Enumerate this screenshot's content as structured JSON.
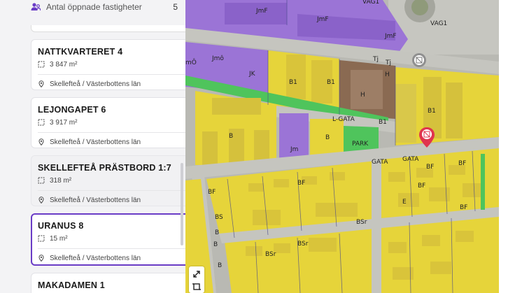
{
  "sidebar": {
    "counter_label": "Antal öppnade fastigheter",
    "counter_value": "5",
    "properties": [
      {
        "name": "NATTKVARTERET 4",
        "area": "3 847 m²",
        "location": "Skellefteå / Västerbottens län"
      },
      {
        "name": "LEJONGAPET 6",
        "area": "3 917 m²",
        "location": "Skellefteå / Västerbottens län"
      },
      {
        "name": "SKELLEFTEÅ PRÄSTBORD 1:7",
        "area": "318 m²",
        "location": "Skellefteå / Västerbottens län"
      },
      {
        "name": "URANUS 8",
        "area": "15 m²",
        "location": "Skellefteå / Västerbottens län"
      },
      {
        "name": "MAKADAMEN 1"
      }
    ]
  },
  "map": {
    "labels": {
      "vag1_top": "VAG1",
      "vag1": "VAG1",
      "jmf1": "JmF",
      "jmf2": "JmF",
      "jmf3": "JmF",
      "jmo1": "Jmô",
      "jmo2": "mÔ",
      "jk": "JK",
      "tj1": "Tj",
      "tj2": "Tj",
      "h1": "H",
      "h2": "H",
      "b1a": "B1",
      "b1b": "B1",
      "b1c": "B1",
      "b1d": "B1",
      "lgata": "L-GATA",
      "b_a": "B",
      "b_b": "B",
      "jm": "Jm",
      "park": "PARK",
      "gata1": "GATA",
      "gata2": "GATA",
      "bf1": "BF",
      "bf2": "BF",
      "bf3": "BF",
      "bf4": "BF",
      "bf5": "BF",
      "bf6": "BF",
      "e": "E",
      "bs": "BS",
      "bsr1": "BSr",
      "bsr2": "BSr",
      "bsr3": "BSr",
      "b_c": "B",
      "b_d": "B",
      "b_e": "B"
    },
    "colors": {
      "residential": "#e6d43a",
      "commercial": "#9b74d6",
      "park": "#4fc45c",
      "road": "#bdbdb8",
      "hospital": "#8a6a52",
      "marker": "#e0344e",
      "selection": "#6a3cc6"
    },
    "tools": [
      "resize-icon",
      "crop-icon"
    ]
  }
}
